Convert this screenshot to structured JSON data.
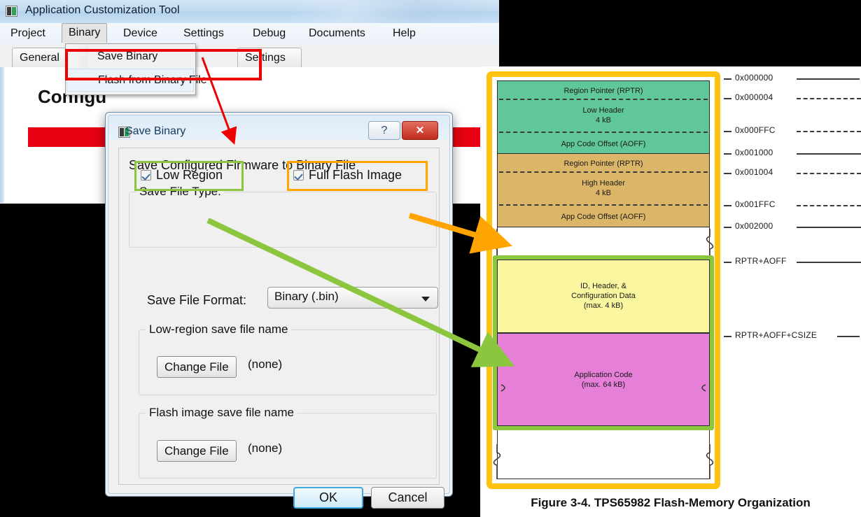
{
  "app": {
    "title": "Application Customization Tool",
    "icon": "app-window-icon",
    "menus": [
      "Project",
      "Binary",
      "Device",
      "Settings",
      "Debug",
      "Documents",
      "Help"
    ],
    "active_menu": "Binary",
    "tabs": [
      "General",
      "Settings"
    ],
    "content_heading": "Configu",
    "dropdown": {
      "items": [
        "Save Binary",
        "Flash from Binary File"
      ],
      "highlighted": "Save Binary"
    }
  },
  "dialog": {
    "title": "Save Binary",
    "icon": "dialog-window-icon",
    "help_button": "?",
    "close_button": "✕",
    "heading": "Save Configured Firmware to Binary File",
    "file_type_group": "Save File Type:",
    "checkboxes": [
      {
        "label": "Low Region",
        "checked": true,
        "highlight": "#8CC63F"
      },
      {
        "label": "Full Flash Image",
        "checked": true,
        "highlight": "#FFA400"
      }
    ],
    "format_label": "Save File Format:",
    "format_value": "Binary (.bin)",
    "low_region_group": "Low-region save file name",
    "low_region_button": "Change File",
    "low_region_value": "(none)",
    "flash_image_group": "Flash image save file name",
    "flash_image_button": "Change File",
    "flash_image_value": "(none)",
    "ok_button": "OK",
    "cancel_button": "Cancel"
  },
  "diagram": {
    "caption": "Figure 3-4. TPS65982 Flash-Memory Organization",
    "frame_color": "#FFC20E",
    "region_highlight_color": "#8CC63F",
    "blocks": [
      {
        "name": "low-region",
        "color": "#5FC79A",
        "top_label": "Region Pointer (RPTR)",
        "mid_label": "Low Header",
        "mid_sub": "4 kB",
        "bottom_label": "App Code Offset (AOFF)"
      },
      {
        "name": "high-region",
        "color": "#DCB668",
        "top_label": "Region Pointer (RPTR)",
        "mid_label": "High Header",
        "mid_sub": "4 kB",
        "bottom_label": "App Code Offset (AOFF)"
      }
    ],
    "config_block": {
      "color": "#FBF7A0",
      "line1": "ID, Header, &",
      "line2": "Configuration Data",
      "line3": "(max. 4 kB)"
    },
    "code_block": {
      "color": "#E67FD8",
      "line1": "Application Code",
      "line2": "(max. 64 kB)"
    },
    "addresses": [
      {
        "label": "0x000000",
        "style": "solid"
      },
      {
        "label": "0x000004",
        "style": "dashed"
      },
      {
        "label": "0x000FFC",
        "style": "dashed"
      },
      {
        "label": "0x001000",
        "style": "solid"
      },
      {
        "label": "0x001004",
        "style": "dashed"
      },
      {
        "label": "0x001FFC",
        "style": "dashed"
      },
      {
        "label": "0x002000",
        "style": "solid"
      },
      {
        "label": "RPTR+AOFF",
        "style": "solid"
      },
      {
        "label": "RPTR+AOFF+CSIZE",
        "style": "solid"
      }
    ]
  }
}
